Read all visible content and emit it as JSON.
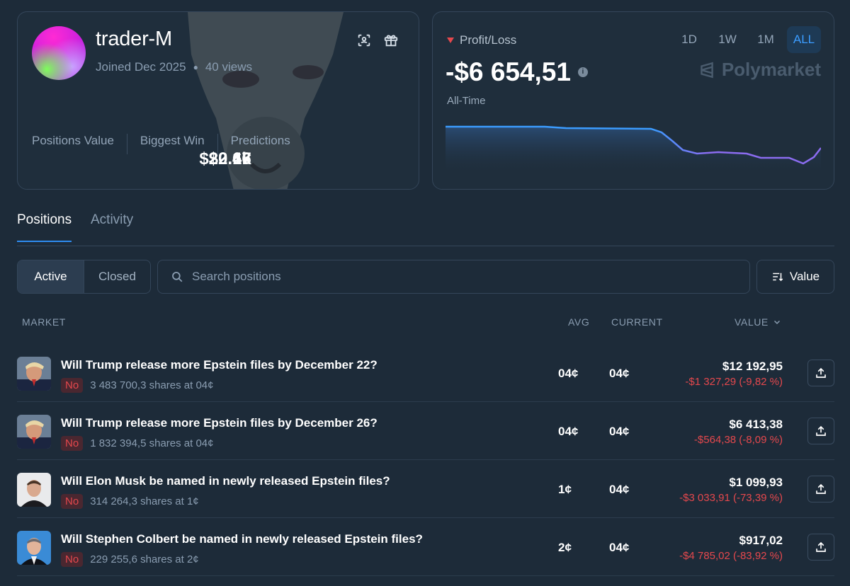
{
  "profile": {
    "username": "trader-M",
    "joined": "Joined Dec 2025",
    "views": "40 views",
    "stats": [
      {
        "label": "Positions Value",
        "value": "$20.6k"
      },
      {
        "label": "Biggest Win",
        "value": "$2.47"
      },
      {
        "label": "Predictions",
        "value": "16"
      }
    ]
  },
  "pnl": {
    "label": "Profit/Loss",
    "value": "-$6 654,51",
    "period_label": "All-Time",
    "ranges": [
      "1D",
      "1W",
      "1M",
      "ALL"
    ],
    "active_range": "ALL",
    "brand": "Polymarket",
    "line_color_start": "#3b9cff",
    "line_color_end": "#8b6cf0"
  },
  "tabs": [
    "Positions",
    "Activity"
  ],
  "filters": {
    "active_label": "Active",
    "closed_label": "Closed",
    "search_placeholder": "Search positions",
    "sort_label": "Value"
  },
  "table": {
    "headers": {
      "market": "MARKET",
      "avg": "AVG",
      "current": "CURRENT",
      "value": "VALUE"
    },
    "rows": [
      {
        "title": "Will Trump release more Epstein files by December 22?",
        "outcome": "No",
        "shares": "3 483 700,3 shares at 04¢",
        "avg": "04¢",
        "current": "04¢",
        "value": "$12 192,95",
        "pnl": "-$1 327,29 (-9,82 %)"
      },
      {
        "title": "Will Trump release more Epstein files by December 26?",
        "outcome": "No",
        "shares": "1 832 394,5 shares at 04¢",
        "avg": "04¢",
        "current": "04¢",
        "value": "$6 413,38",
        "pnl": "-$564,38 (-8,09 %)"
      },
      {
        "title": "Will Elon Musk be named in newly released Epstein files?",
        "outcome": "No",
        "shares": "314 264,3 shares at 1¢",
        "avg": "1¢",
        "current": "04¢",
        "value": "$1 099,93",
        "pnl": "-$3 033,91 (-73,39 %)"
      },
      {
        "title": "Will Stephen Colbert be named in newly released Epstein files?",
        "outcome": "No",
        "shares": "229 255,6 shares at 2¢",
        "avg": "2¢",
        "current": "04¢",
        "value": "$917,02",
        "pnl": "-$4 785,02 (-83,92 %)"
      }
    ]
  },
  "colors": {
    "accent": "#2e8cf0",
    "loss": "#e5484d",
    "background": "#1d2b39"
  }
}
